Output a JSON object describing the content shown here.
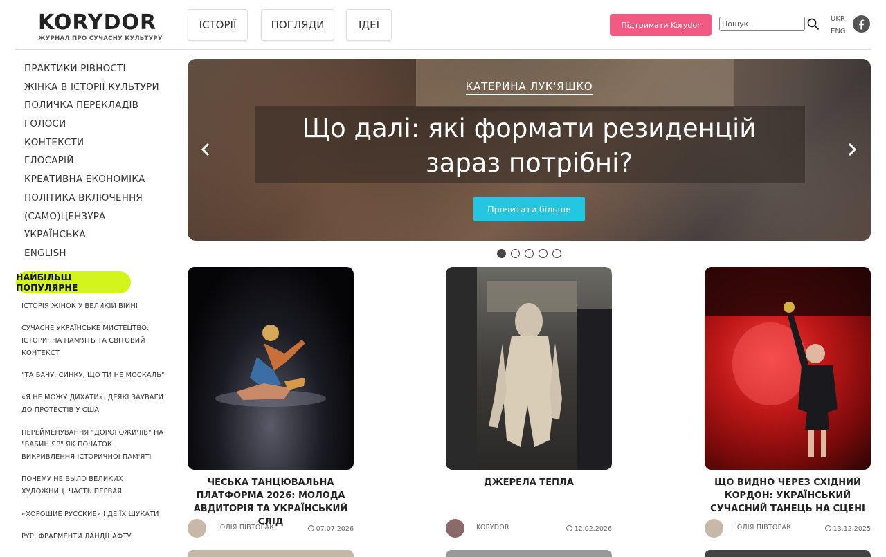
{
  "header": {
    "logo": {
      "word": "KORYDOR",
      "tagline": "ЖУРНАЛ ПРО СУЧАСНУ КУЛЬТУРУ"
    },
    "tabs": [
      "ІСТОРІЇ",
      "ПОГЛЯДИ",
      "ІДЕЇ"
    ],
    "support_label": "Підтримати Korydor",
    "search_placeholder": "Пошук",
    "lang_ukr": "UKR",
    "lang_eng": "ENG"
  },
  "sidebar": {
    "categories": [
      "ПРАКТИКИ РІВНОСТІ",
      "ЖІНКА В ІСТОРІЇ КУЛЬТУРИ",
      "ПОЛИЧКА ПЕРЕКЛАДІВ",
      "ГОЛОСИ",
      "КОНТЕКСТИ",
      "ГЛОСАРІЙ",
      "КРЕАТИВНА ЕКОНОМІКА",
      "ПОЛІТИКА ВКЛЮЧЕННЯ",
      "(САМО)ЦЕНЗУРА",
      "УКРАЇНСЬКА",
      "ENGLISH"
    ],
    "popular_label": "НАЙБІЛЬШ ПОПУЛЯРНЕ",
    "popular": [
      "ІСТОРІЯ ЖІНОК У ВЕЛИКІЙ ВІЙНІ",
      "СУЧАСНЕ УКРАЇНСЬКЕ МИСТЕЦТВО: ІСТОРИЧНА ПАМ'ЯТЬ ТА СВІТОВИЙ КОНТЕКСТ",
      "\"ТА БАЧУ, СИНКУ, ЩО ТИ НЕ МОСКАЛЬ\"",
      "«Я НЕ МОЖУ ДИХАТИ»: ДЕЯКІ ЗАУВАГИ ДО ПРОТЕСТІВ У США",
      "ПЕРЕЙМЕНУВАННЯ \"ДОРОГОЖИЧІВ\" НА \"БАБИН ЯР\" ЯК ПОЧАТОК ВИКРИВЛЕННЯ ІСТОРИЧНОЇ ПАМ'ЯТІ",
      "ПОЧЕМУ НЕ БЫЛО ВЕЛИКИХ ХУДОЖНИЦ. ЧАСТЬ ПЕРВАЯ",
      "«ХОРОШИЕ РУССКИЕ» І ДЕ ЇХ ШУКАТИ",
      "PYP: ФРАГМЕНТИ ЛАНДШАФТУ"
    ]
  },
  "hero": {
    "author": "КАТЕРИНА ЛУК'ЯШКО",
    "title": "Що далі: які формати резиденцій зараз потрібні?",
    "button": "Прочитати більше",
    "slide_count": 5,
    "active_slide": 1
  },
  "cards": [
    {
      "title": "ЧЕСЬКА ТАНЦЮВАЛЬНА ПЛАТФОРМА 2026: МОЛОДА АВДИТОРІЯ ТА УКРАЇНСЬКИЙ СЛІД",
      "author": "ЮЛІЯ ПІВТОРАК",
      "date": "07.07.2026"
    },
    {
      "title": "ДЖЕРЕЛА ТЕПЛА",
      "author": "KORYDOR",
      "date": "12.02.2026"
    },
    {
      "title": "ЩО ВИДНО ЧЕРЕЗ СХІДНИЙ КОРДОН: УКРАЇНСЬКИЙ СУЧАСНИЙ ТАНЕЦЬ НА СЦЕНІ",
      "author": "ЮЛІЯ ПІВТОРАК",
      "date": "13.12.2025"
    }
  ],
  "colors": {
    "accent_pink": "#f25a84",
    "accent_cyan": "#25c6e0",
    "popular_lime": "#d4f51a"
  }
}
